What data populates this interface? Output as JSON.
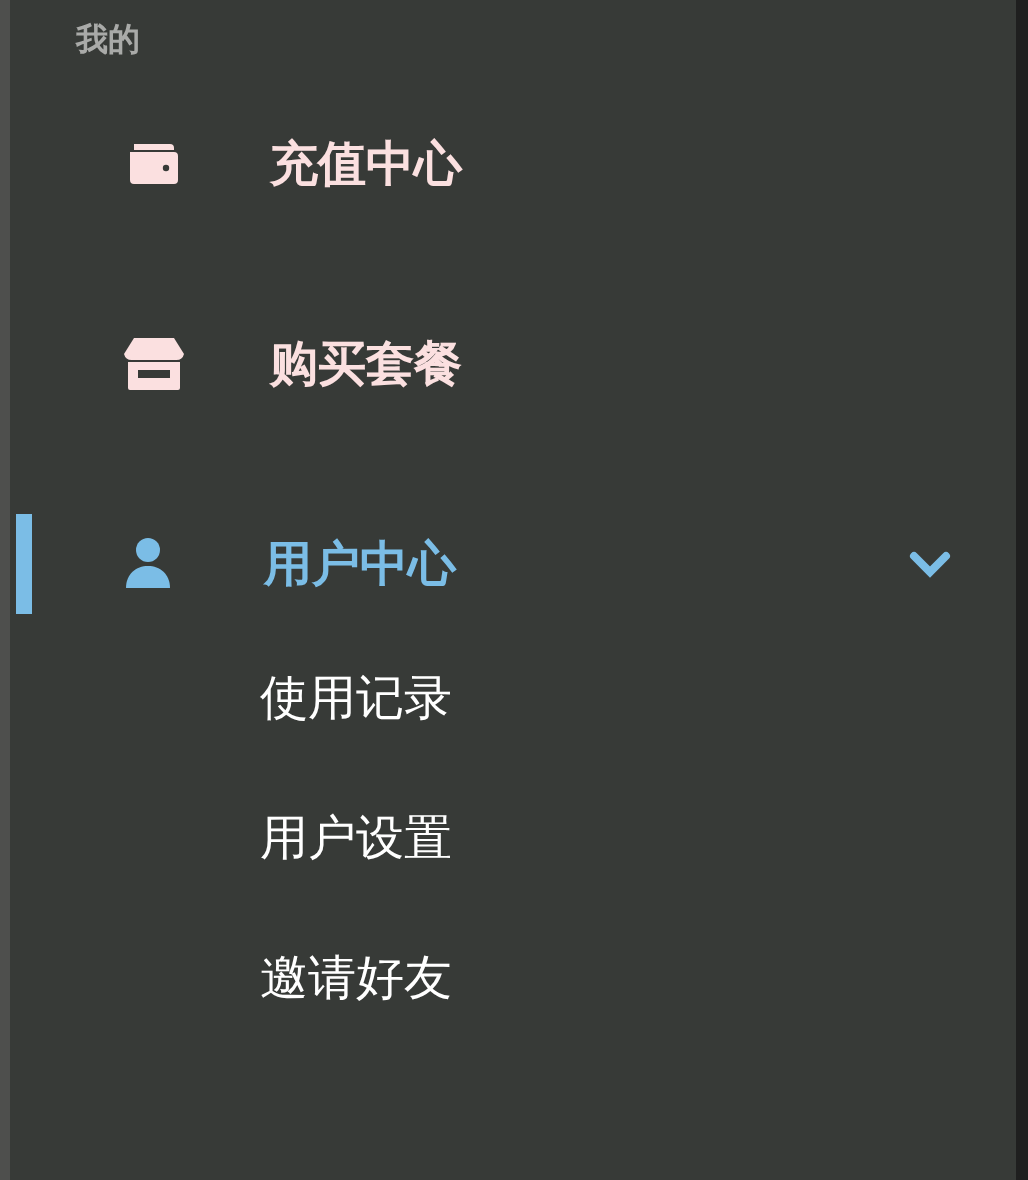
{
  "section_title": "我的",
  "menu": [
    {
      "label": "充值中心",
      "selected": false
    },
    {
      "label": "购买套餐",
      "selected": false
    },
    {
      "label": "用户中心",
      "selected": true,
      "expanded": true,
      "children": [
        {
          "label": "使用记录"
        },
        {
          "label": "用户设置"
        },
        {
          "label": "邀请好友"
        }
      ]
    }
  ]
}
